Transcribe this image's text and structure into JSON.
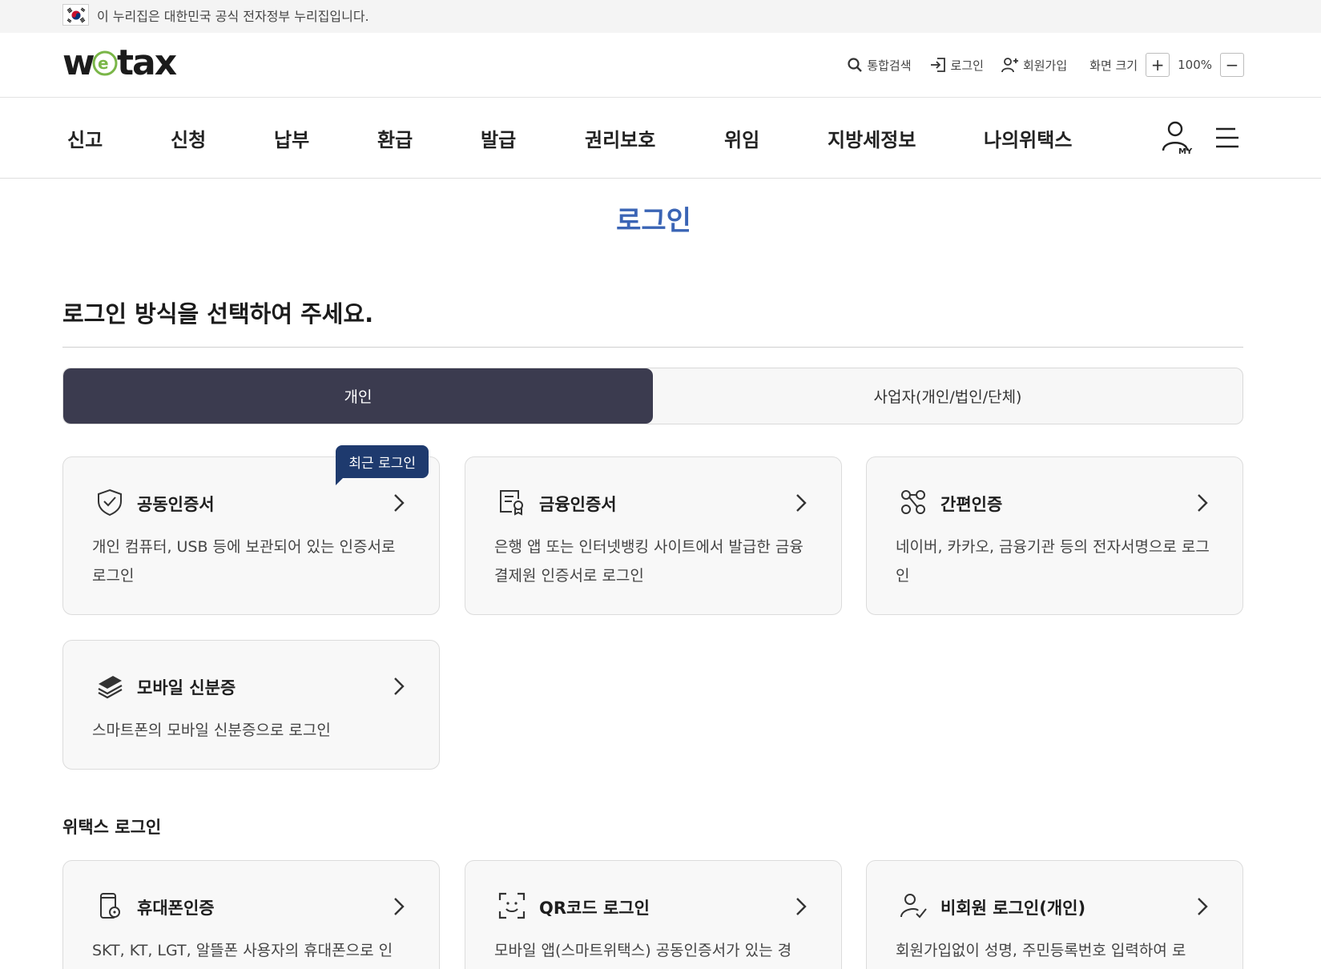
{
  "gov_banner": {
    "text": "이 누리집은 대한민국 공식 전자정부 누리집입니다."
  },
  "header": {
    "logo_text": "wetax",
    "util": {
      "search": "통합검색",
      "login": "로그인",
      "signup": "회원가입",
      "zoom_label": "화면 크기",
      "zoom_in": "+",
      "zoom_value": "100%",
      "zoom_out": "−"
    }
  },
  "nav": {
    "items": [
      "신고",
      "신청",
      "납부",
      "환급",
      "발급",
      "권리보호",
      "위임",
      "지방세정보",
      "나의위택스"
    ],
    "my_label": "MY"
  },
  "main": {
    "page_title": "로그인",
    "sub_heading": "로그인 방식을 선택하여 주세요.",
    "tabs": [
      {
        "label": "개인",
        "active": true
      },
      {
        "label": "사업자(개인/법인/단체)",
        "active": false
      }
    ],
    "cards": [
      {
        "title": "공동인증서",
        "desc": "개인 컴퓨터, USB 등에 보관되어 있는 인증서로 로그인",
        "badge": "최근 로그인",
        "icon": "shield-check-icon"
      },
      {
        "title": "금융인증서",
        "desc": "은행 앱 또는 인터넷뱅킹 사이트에서 발급한 금융결제원 인증서로 로그인",
        "icon": "certificate-icon"
      },
      {
        "title": "간편인증",
        "desc": "네이버, 카카오, 금융기관 등의 전자서명으로 로그인",
        "icon": "nodes-icon"
      },
      {
        "title": "모바일 신분증",
        "desc": "스마트폰의 모바일 신분증으로 로그인",
        "icon": "layers-icon"
      }
    ],
    "wetax_section_title": "위택스 로그인",
    "wetax_cards": [
      {
        "title": "휴대폰인증",
        "desc": "SKT, KT, LGT, 알뜰폰 사용자의 휴대폰으로 인",
        "icon": "phone-icon"
      },
      {
        "title": "QR코드 로그인",
        "desc": "모바일 앱(스마트위택스) 공동인증서가 있는 경",
        "icon": "qr-scan-icon"
      },
      {
        "title": "비회원 로그인(개인)",
        "desc": "회원가입없이 성명, 주민등록번호 입력하여 로",
        "icon": "user-check-icon"
      }
    ]
  },
  "colors": {
    "accent_blue": "#3a64b5",
    "tab_active": "#3b3b4f",
    "badge": "#1e3a6e",
    "logo_green": "#7ab648"
  }
}
